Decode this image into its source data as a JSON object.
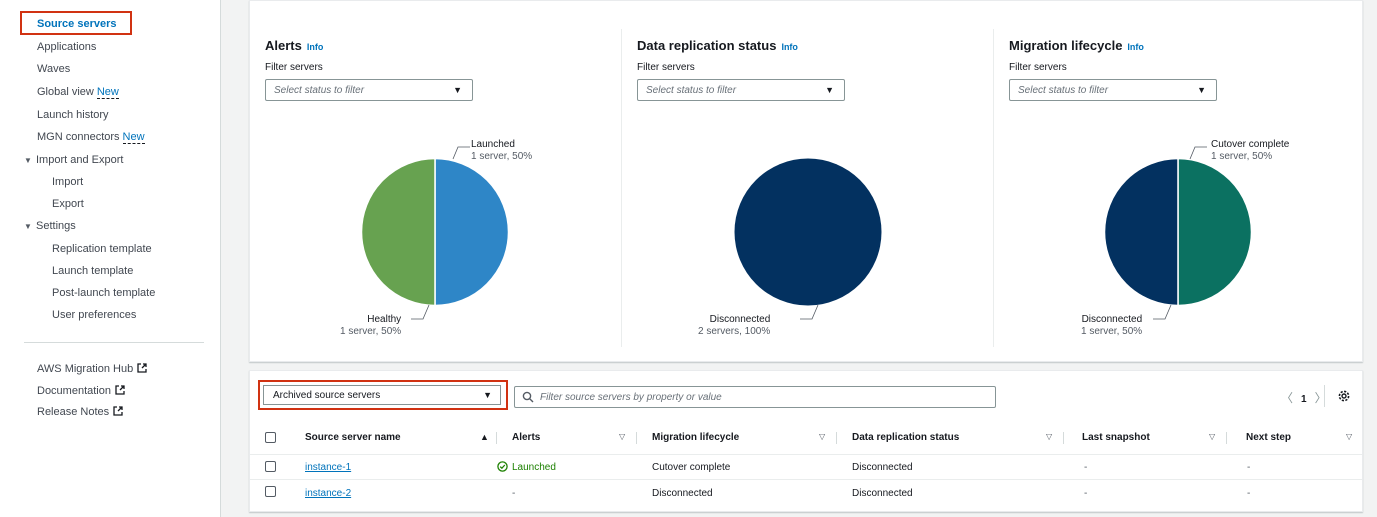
{
  "sidebar": {
    "active": "Source servers",
    "items": [
      {
        "label": "Applications"
      },
      {
        "label": "Waves"
      },
      {
        "label": "Global view",
        "badge": "New"
      },
      {
        "label": "Launch history"
      },
      {
        "label": "MGN connectors",
        "badge": "New"
      }
    ],
    "import_export": {
      "label": "Import and Export",
      "items": [
        "Import",
        "Export"
      ]
    },
    "settings": {
      "label": "Settings",
      "items": [
        "Replication template",
        "Launch template",
        "Post-launch template",
        "User preferences"
      ]
    },
    "footer_links": [
      "AWS Migration Hub",
      "Documentation",
      "Release Notes"
    ]
  },
  "panels": {
    "alerts": {
      "title": "Alerts",
      "info": "Info",
      "filter_label": "Filter servers",
      "filter_placeholder": "Select status to filter",
      "slices": [
        {
          "label": "Launched",
          "detail": "1 server, 50%",
          "value": 50,
          "color": "#2e86c7"
        },
        {
          "label": "Healthy",
          "detail": "1 server, 50%",
          "value": 50,
          "color": "#67a250"
        }
      ]
    },
    "replication": {
      "title": "Data replication status",
      "info": "Info",
      "filter_label": "Filter servers",
      "filter_placeholder": "Select status to filter",
      "slices": [
        {
          "label": "Disconnected",
          "detail": "2 servers, 100%",
          "value": 100,
          "color": "#033160"
        }
      ]
    },
    "lifecycle": {
      "title": "Migration lifecycle",
      "info": "Info",
      "filter_label": "Filter servers",
      "filter_placeholder": "Select status to filter",
      "slices": [
        {
          "label": "Cutover complete",
          "detail": "1 server, 50%",
          "value": 50,
          "color": "#0b7161"
        },
        {
          "label": "Disconnected",
          "detail": "1 server, 50%",
          "value": 50,
          "color": "#033160"
        }
      ]
    }
  },
  "table": {
    "view_select": "Archived source servers",
    "filter_placeholder": "Filter source servers by property or value",
    "page": "1",
    "columns": [
      "Source server name",
      "Alerts",
      "Migration lifecycle",
      "Data replication status",
      "Last snapshot",
      "Next step"
    ],
    "rows": [
      {
        "name": "instance-1",
        "alerts": "Launched",
        "lifecycle": "Cutover complete",
        "replication": "Disconnected",
        "snapshot": "-",
        "next": "-"
      },
      {
        "name": "instance-2",
        "alerts": "-",
        "lifecycle": "Disconnected",
        "replication": "Disconnected",
        "snapshot": "-",
        "next": "-"
      }
    ]
  },
  "colors": {
    "accent": "#0073bb",
    "highlight": "#d13212",
    "success": "#1d8102"
  }
}
